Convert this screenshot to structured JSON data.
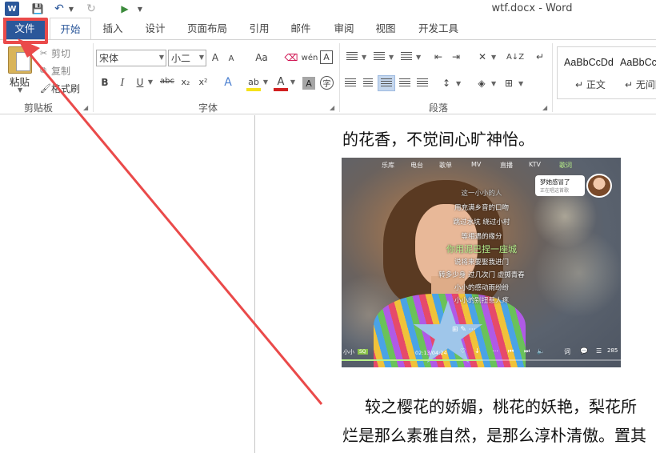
{
  "titlebar": {
    "word_logo": "W",
    "title": "wtf.docx - Word"
  },
  "tabs": [
    "文件",
    "开始",
    "插入",
    "设计",
    "页面布局",
    "引用",
    "邮件",
    "审阅",
    "视图",
    "开发工具"
  ],
  "clipboard": {
    "group_label": "剪贴板",
    "paste": "粘贴",
    "cut": "剪切",
    "copy": "复制",
    "format_painter": "格式刷"
  },
  "font": {
    "group_label": "字体",
    "font_name": "宋体",
    "font_size": "小二",
    "grow": "A",
    "shrink": "A",
    "case": "Aa",
    "phonetic": "wén",
    "border_char": "A",
    "bold": "B",
    "italic": "I",
    "underline": "U",
    "strike": "abc",
    "subscript": "x₂",
    "superscript": "x²",
    "effects": "A",
    "highlight": "ab",
    "font_color": "A",
    "shade": "A",
    "enclose": "字",
    "highlight_color": "#f5e21a",
    "font_color_value": "#d12020"
  },
  "paragraph": {
    "group_label": "段落",
    "sort": "A↓Z",
    "marks": "↵"
  },
  "styles": {
    "items": [
      {
        "sample": "AaBbCcDd",
        "name": "↵ 正文"
      },
      {
        "sample": "AaBbCcDd",
        "name": "↵ 无间隔"
      }
    ]
  },
  "document": {
    "line1": "的花香，不觉间心旷神怡。",
    "line2": "较之樱花的娇媚，桃花的妖艳，梨花所",
    "line3": "烂是那么素雅自然，是那么淳朴清傲。置其"
  },
  "music_app": {
    "nav": [
      "乐库",
      "电台",
      "歌单",
      "MV",
      "直播",
      "KTV",
      "歌词"
    ],
    "bubble_title": "梦她感冒了",
    "bubble_sub": "正在唱这首歌",
    "lyrics": [
      "这一小小的人",
      "用充满乡音的口吻",
      "跳过水坑 绕过小村",
      "等相遇的缘分",
      "你用泥巴捏一座城",
      "说将来要娶我进门",
      "转多少身 过几次门 虚掷青春",
      "小小的感动雨纷纷",
      "小小的别扭惹人疼"
    ],
    "now_playing": "小小",
    "quality_badge": "SQ",
    "play_time": "02:13/04:24",
    "progress": 0.5,
    "comment_count": "285",
    "controls": {
      "heart": "♡",
      "download": "↓",
      "more": "⋯",
      "prev": "⏮",
      "next": "⏭",
      "volume": "🔈",
      "lyric": "词",
      "comment": "💬",
      "list": "☰"
    }
  },
  "annotation": {
    "color": "#ea4a4a",
    "target": "文件"
  }
}
